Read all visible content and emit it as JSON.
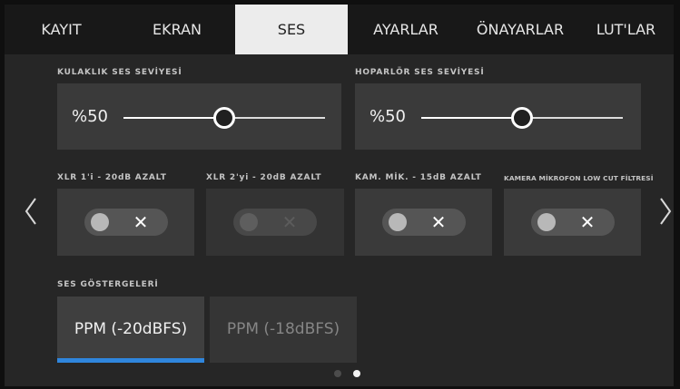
{
  "tabs": [
    {
      "label": "KAYIT",
      "active": false
    },
    {
      "label": "EKRAN",
      "active": false
    },
    {
      "label": "SES",
      "active": true
    },
    {
      "label": "AYARLAR",
      "active": false
    },
    {
      "label": "ÖNAYARLAR",
      "active": false
    },
    {
      "label": "LUT'LAR",
      "active": false
    }
  ],
  "headphone": {
    "label": "KULAKLIK SES SEVİYESİ",
    "value_text": "%50",
    "level_percent": 50
  },
  "speaker": {
    "label": "HOPARLÖR SES SEVİYESİ",
    "value_text": "%50",
    "level_percent": 50
  },
  "toggles": [
    {
      "label": "XLR 1'i - 20dB AZALT",
      "state": "off",
      "enabled": true,
      "icon": "x-icon"
    },
    {
      "label": "XLR 2'yi - 20dB AZALT",
      "state": "off",
      "enabled": false,
      "icon": "x-icon"
    },
    {
      "label": "KAM. MİK. - 15dB AZALT",
      "state": "off",
      "enabled": true,
      "icon": "x-icon"
    },
    {
      "label": "KAMERA MİKROFON LOW CUT FİLTRESİ",
      "state": "off",
      "enabled": true,
      "icon": "x-icon"
    }
  ],
  "meters": {
    "label": "SES GÖSTERGELERİ",
    "options": [
      {
        "label": "PPM (-20dBFS)",
        "selected": true
      },
      {
        "label": "PPM (-18dBFS)",
        "selected": false
      }
    ]
  },
  "pager": {
    "current": 2,
    "total": 2
  },
  "icons": {
    "prev": "chevron-left-icon",
    "next": "chevron-right-icon",
    "toggle_mark": "x-icon"
  },
  "colors": {
    "accent": "#2f86dd",
    "active_tab_bg": "#ececec",
    "card_bg": "#3a3a3a",
    "background": "#262626"
  }
}
